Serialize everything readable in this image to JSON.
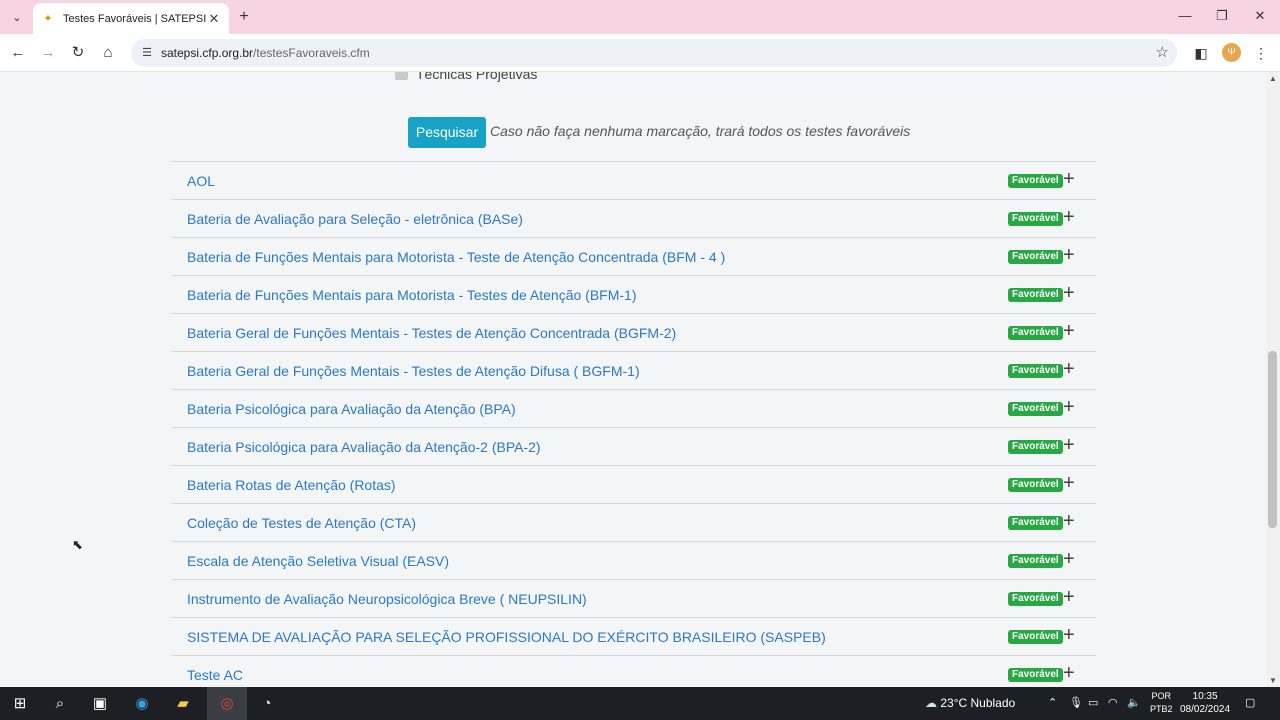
{
  "browser": {
    "tab_title": "Testes Favoráveis | SATEPSI",
    "url_host": "satepsi.cfp.org.br",
    "url_path": "/testesFavoraveis.cfm"
  },
  "filters": {
    "last_option": "Técnicas Projetivas",
    "search_button": "Pesquisar",
    "hint": "Caso não faça nenhuma marcação, trará todos os testes favoráveis"
  },
  "tests": [
    {
      "name": "AOL",
      "status": "Favorável"
    },
    {
      "name": "Bateria de Avaliação para Seleção - eletrônica (BASe)",
      "status": "Favorável"
    },
    {
      "name": "Bateria de Funções Mentais para Motorista - Teste de Atenção Concentrada (BFM - 4 )",
      "status": "Favorável"
    },
    {
      "name": "Bateria de Funções Mentais para Motorista - Testes de Atenção (BFM-1)",
      "status": "Favorável"
    },
    {
      "name": "Bateria Geral de Funções Mentais - Testes de Atenção Concentrada (BGFM-2)",
      "status": "Favorável"
    },
    {
      "name": "Bateria Geral de Funções Mentais - Testes de Atenção Difusa ( BGFM-1)",
      "status": "Favorável"
    },
    {
      "name": "Bateria Psicológica para Avaliação da Atenção (BPA)",
      "status": "Favorável"
    },
    {
      "name": "Bateria Psicológica para Avaliação da Atenção-2 (BPA-2)",
      "status": "Favorável"
    },
    {
      "name": "Bateria Rotas de Atenção (Rotas)",
      "status": "Favorável"
    },
    {
      "name": "Coleção de Testes de Atenção (CTA)",
      "status": "Favorável"
    },
    {
      "name": "Escala de Atenção Seletiva Visual (EASV)",
      "status": "Favorável"
    },
    {
      "name": "Instrumento de Avaliação Neuropsicológica Breve ( NEUPSILIN)",
      "status": "Favorável"
    },
    {
      "name": "SISTEMA DE AVALIAÇÃO PARA SELEÇÃO PROFISSIONAL DO EXÉRCITO BRASILEIRO (SASPEB)",
      "status": "Favorável"
    },
    {
      "name": "Teste AC",
      "status": "Favorável"
    }
  ],
  "taskbar": {
    "weather": "23°C  Nublado",
    "lang_1": "POR",
    "lang_2": "PTB2",
    "time": "10:35",
    "date": "08/02/2024"
  },
  "colors": {
    "link": "#2a79c2",
    "badge": "#28a745",
    "button": "#17a2c6"
  }
}
